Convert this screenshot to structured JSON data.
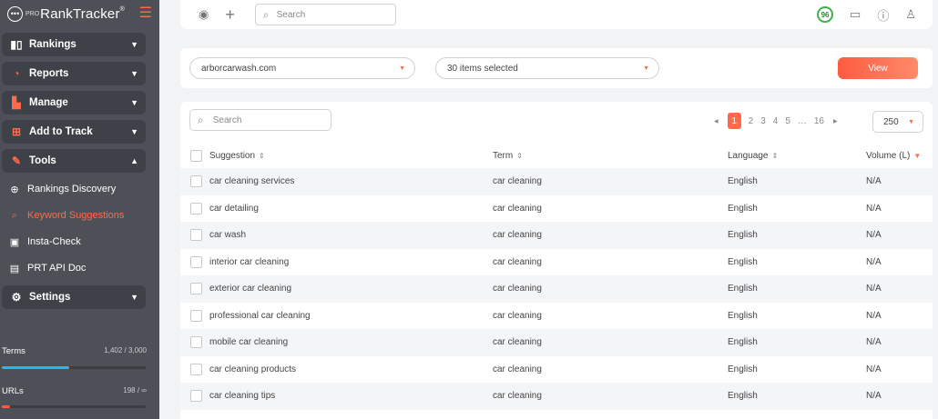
{
  "brand": {
    "pro": "PRO",
    "name": "RankTracker",
    "tm": "®"
  },
  "sidebar": {
    "groups": [
      {
        "id": "rankings",
        "label": "Rankings",
        "icon": "bar-chart-icon",
        "expanded": false
      },
      {
        "id": "reports",
        "label": "Reports",
        "icon": "pie-chart-icon",
        "expanded": false
      },
      {
        "id": "manage",
        "label": "Manage",
        "icon": "document-gear-icon",
        "expanded": false
      },
      {
        "id": "add-to-track",
        "label": "Add to Track",
        "icon": "plus-box-icon",
        "expanded": false
      },
      {
        "id": "tools",
        "label": "Tools",
        "icon": "wrench-icon",
        "expanded": true
      },
      {
        "id": "settings",
        "label": "Settings",
        "icon": "gear-icon",
        "expanded": false
      }
    ],
    "tool_items": [
      {
        "label": "Rankings Discovery",
        "icon": "globe-icon",
        "active": false
      },
      {
        "label": "Keyword Suggestions",
        "icon": "search-icon",
        "active": true
      },
      {
        "label": "Insta-Check",
        "icon": "calendar-icon",
        "active": false
      },
      {
        "label": "PRT API Doc",
        "icon": "api-doc-icon",
        "active": false
      }
    ],
    "usage": [
      {
        "label": "Terms",
        "value": "1,402 / 3,000",
        "fraction": 0.467,
        "color": "#29b6f6"
      },
      {
        "label": "URLs",
        "value": "198 / ∞",
        "fraction": 0.06,
        "color": "#ff5b3f"
      }
    ]
  },
  "topbar": {
    "search_placeholder": "Search",
    "score": "96",
    "icons": [
      "eye-icon",
      "plus-icon",
      "chat-icon",
      "help-icon",
      "user-icon"
    ]
  },
  "filters": {
    "domain": "arborcarwash.com",
    "items": "30 items selected",
    "view_label": "View"
  },
  "table": {
    "search_placeholder": "Search",
    "pages": [
      "1",
      "2",
      "3",
      "4",
      "5",
      "…",
      "16"
    ],
    "current_page": "1",
    "per_page": "250",
    "columns": {
      "suggestion": "Suggestion",
      "term": "Term",
      "language": "Language",
      "volume": "Volume (L)"
    },
    "rows": [
      {
        "suggestion": "car cleaning services",
        "term": "car cleaning",
        "language": "English",
        "volume": "N/A"
      },
      {
        "suggestion": "car detailing",
        "term": "car cleaning",
        "language": "English",
        "volume": "N/A"
      },
      {
        "suggestion": "car wash",
        "term": "car cleaning",
        "language": "English",
        "volume": "N/A"
      },
      {
        "suggestion": "interior car cleaning",
        "term": "car cleaning",
        "language": "English",
        "volume": "N/A"
      },
      {
        "suggestion": "exterior car cleaning",
        "term": "car cleaning",
        "language": "English",
        "volume": "N/A"
      },
      {
        "suggestion": "professional car cleaning",
        "term": "car cleaning",
        "language": "English",
        "volume": "N/A"
      },
      {
        "suggestion": "mobile car cleaning",
        "term": "car cleaning",
        "language": "English",
        "volume": "N/A"
      },
      {
        "suggestion": "car cleaning products",
        "term": "car cleaning",
        "language": "English",
        "volume": "N/A"
      },
      {
        "suggestion": "car cleaning tips",
        "term": "car cleaning",
        "language": "English",
        "volume": "N/A"
      }
    ]
  }
}
